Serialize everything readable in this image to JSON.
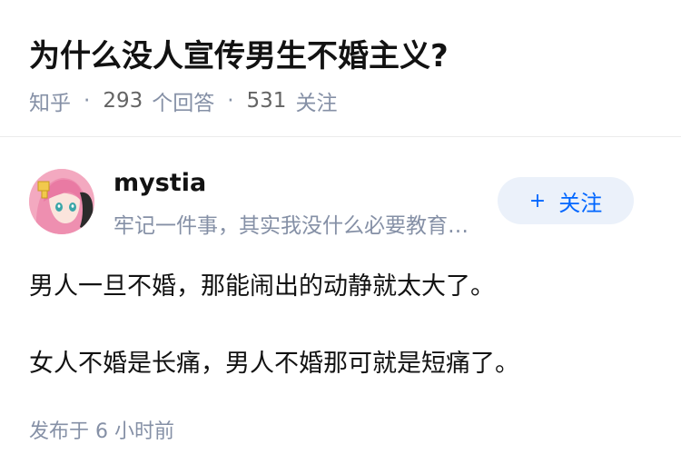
{
  "question": {
    "title": "为什么没人宣传男生不婚主义?",
    "source": "知乎",
    "answer_count": "293",
    "answer_label": "个回答",
    "follower_count": "531",
    "follower_label": "关注"
  },
  "author": {
    "name": "mystia",
    "bio": "牢记一件事，其实我没什么必要教育你们……",
    "follow_label": "关注",
    "follow_icon": "plus-icon"
  },
  "answer": {
    "paragraphs": [
      "男人一旦不婚，那能闹出的动静就太大了。",
      "女人不婚是长痛，男人不婚那可就是短痛了。"
    ],
    "publish_time": "发布于  6 小时前"
  },
  "colors": {
    "accent": "#0066ff",
    "follow_bg": "#ebf1fa",
    "meta_text": "#8590a6"
  }
}
